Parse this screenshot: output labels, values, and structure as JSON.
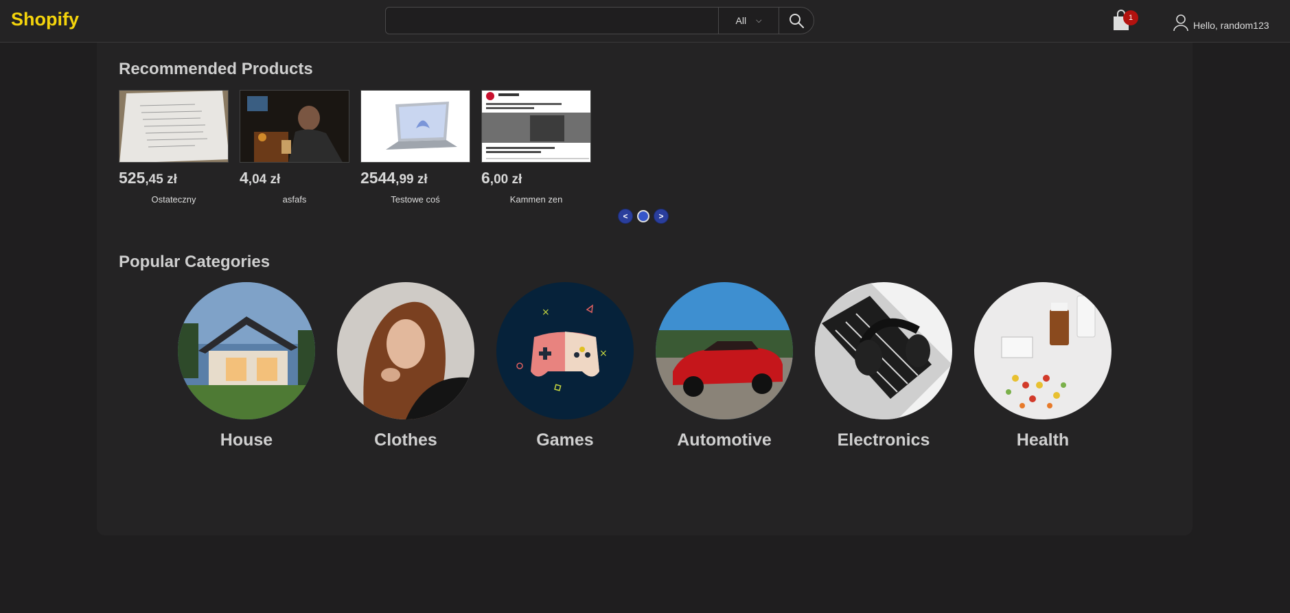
{
  "header": {
    "logo": "Shopify",
    "search": {
      "value": "",
      "placeholder": ""
    },
    "category_select": "All",
    "cart_count": "1",
    "greeting": "Hello, random123"
  },
  "recommended": {
    "title": "Recommended Products",
    "products": [
      {
        "price_int": "525",
        "price_dec": ",45 zł",
        "name": "Ostateczny",
        "image": "document-photo"
      },
      {
        "price_int": "4",
        "price_dec": ",04 zł",
        "name": "asfafs",
        "image": "man-with-drink-photo"
      },
      {
        "price_int": "2544",
        "price_dec": ",99 zł",
        "name": "Testowe coś",
        "image": "laptop-photo"
      },
      {
        "price_int": "6",
        "price_dec": ",00 zł",
        "name": "Kammen zen",
        "image": "social-post-screenshot"
      }
    ],
    "prev_label": "<",
    "next_label": ">"
  },
  "categories": {
    "title": "Popular Categories",
    "items": [
      {
        "label": "House",
        "image": "house-photo"
      },
      {
        "label": "Clothes",
        "image": "woman-portrait-photo"
      },
      {
        "label": "Games",
        "image": "gamepad-illustration"
      },
      {
        "label": "Automotive",
        "image": "red-car-photo"
      },
      {
        "label": "Electronics",
        "image": "headphones-laptop-photo"
      },
      {
        "label": "Health",
        "image": "pills-photo"
      }
    ]
  },
  "colors": {
    "logo": "#f4d40c",
    "background": "#1f1e1f",
    "panel": "#242324",
    "cart_badge": "#b3120f",
    "carousel_button": "#2a3e9c"
  }
}
